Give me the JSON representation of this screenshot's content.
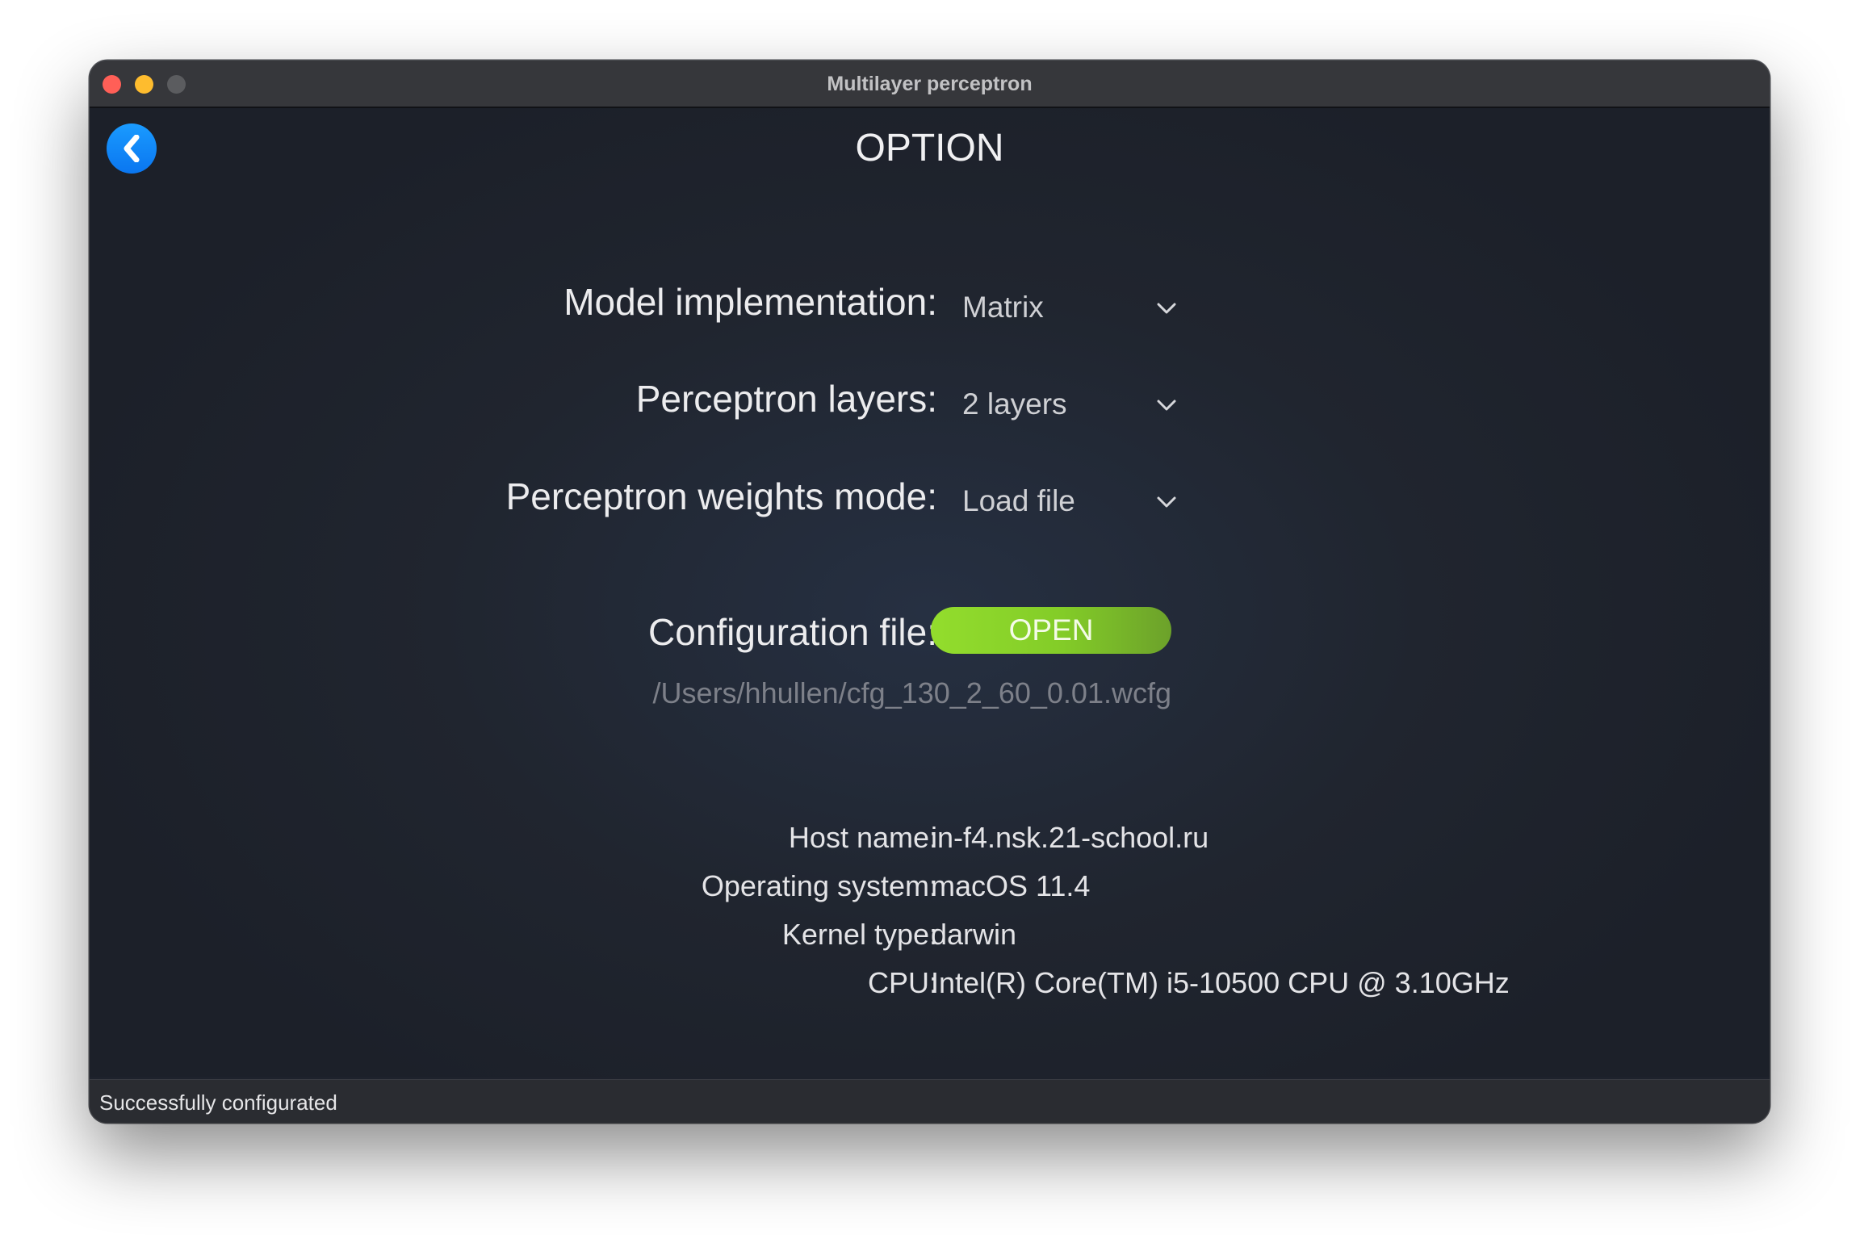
{
  "window": {
    "title": "Multilayer perceptron"
  },
  "page": {
    "title": "OPTION",
    "back_icon": "chevron-left-icon"
  },
  "form": {
    "model_implementation": {
      "label": "Model implementation:",
      "value": "Matrix"
    },
    "perceptron_layers": {
      "label": "Perceptron layers:",
      "value": "2 layers"
    },
    "weights_mode": {
      "label": "Perceptron weights mode:",
      "value": "Load file"
    },
    "configuration_file": {
      "label": "Configuration file:",
      "button_label": "OPEN",
      "path": "/Users/hhullen/cfg_130_2_60_0.01.wcfg"
    }
  },
  "system_info": {
    "host_name": {
      "label": "Host name:",
      "value": "in-f4.nsk.21-school.ru"
    },
    "operating_system": {
      "label": "Operating system:",
      "value": "macOS 11.4"
    },
    "kernel_type": {
      "label": "Kernel type:",
      "value": "darwin"
    },
    "cpu": {
      "label": "CPU:",
      "value": "Intel(R) Core(TM) i5-10500 CPU @ 3.10GHz"
    }
  },
  "status": {
    "text": "Successfully configurated"
  },
  "colors": {
    "accent_blue": "#0a84ff",
    "open_button_green": "#8ad42b",
    "close": "#ff5f57",
    "minimize": "#febc2e"
  }
}
